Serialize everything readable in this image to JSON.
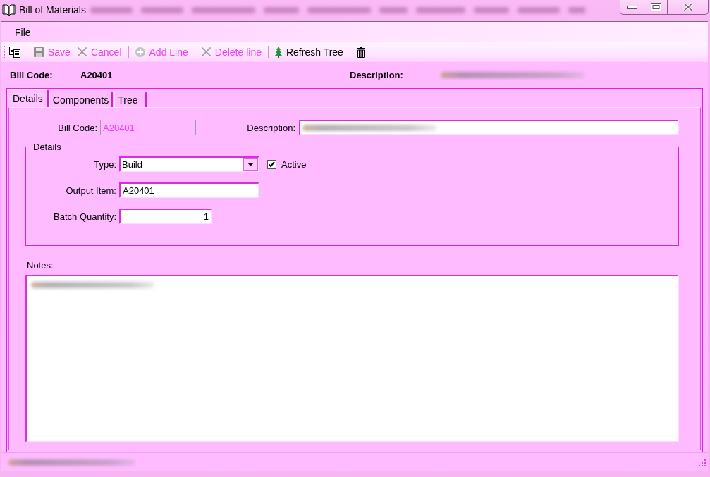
{
  "window": {
    "title": "Bill of Materials",
    "background_blurred": true
  },
  "menu_bar": [
    {
      "label": "File"
    }
  ],
  "toolbar": {
    "groups": [
      {
        "items": [
          {
            "disabled": false
          }
        ]
      },
      {
        "items": [
          {
            "label": "Save",
            "disabled": true
          },
          {
            "label": "Cancel",
            "disabled": true
          }
        ]
      },
      {
        "items": [
          {
            "label": "Add Line",
            "disabled": true
          }
        ]
      },
      {
        "items": [
          {
            "label": "Delete line",
            "disabled": true
          }
        ]
      },
      {
        "items": [
          {
            "label": "Refresh Tree",
            "disabled": false
          }
        ]
      },
      {
        "items": [
          {
            "disabled": false
          }
        ]
      }
    ]
  },
  "header": {
    "bill_code": {
      "label": "Bill Code:",
      "value": "A20401"
    },
    "description": {
      "label": "Description:",
      "blurred": true
    }
  },
  "tabs": [
    {
      "label": "Details",
      "selected": true
    },
    {
      "label": "Components",
      "selected": false
    },
    {
      "label": "Tree",
      "selected": false
    }
  ],
  "details": {
    "bill_code": {
      "label": "Bill Code:",
      "value": "A20401",
      "disabled": true
    },
    "description": {
      "label": "Description:",
      "blurred": true
    },
    "group": {
      "title": "Details",
      "type": {
        "label": "Type:",
        "value": "Build"
      },
      "active": {
        "label": "Active",
        "checked": true
      },
      "output_item": {
        "label": "Output Item:",
        "value": "A20401"
      },
      "batch_quantity": {
        "label": "Batch Quantity:",
        "value": "1"
      }
    },
    "notes": {
      "label": "Notes:",
      "blurred": true
    }
  },
  "status_bar": {
    "blurred": true
  }
}
